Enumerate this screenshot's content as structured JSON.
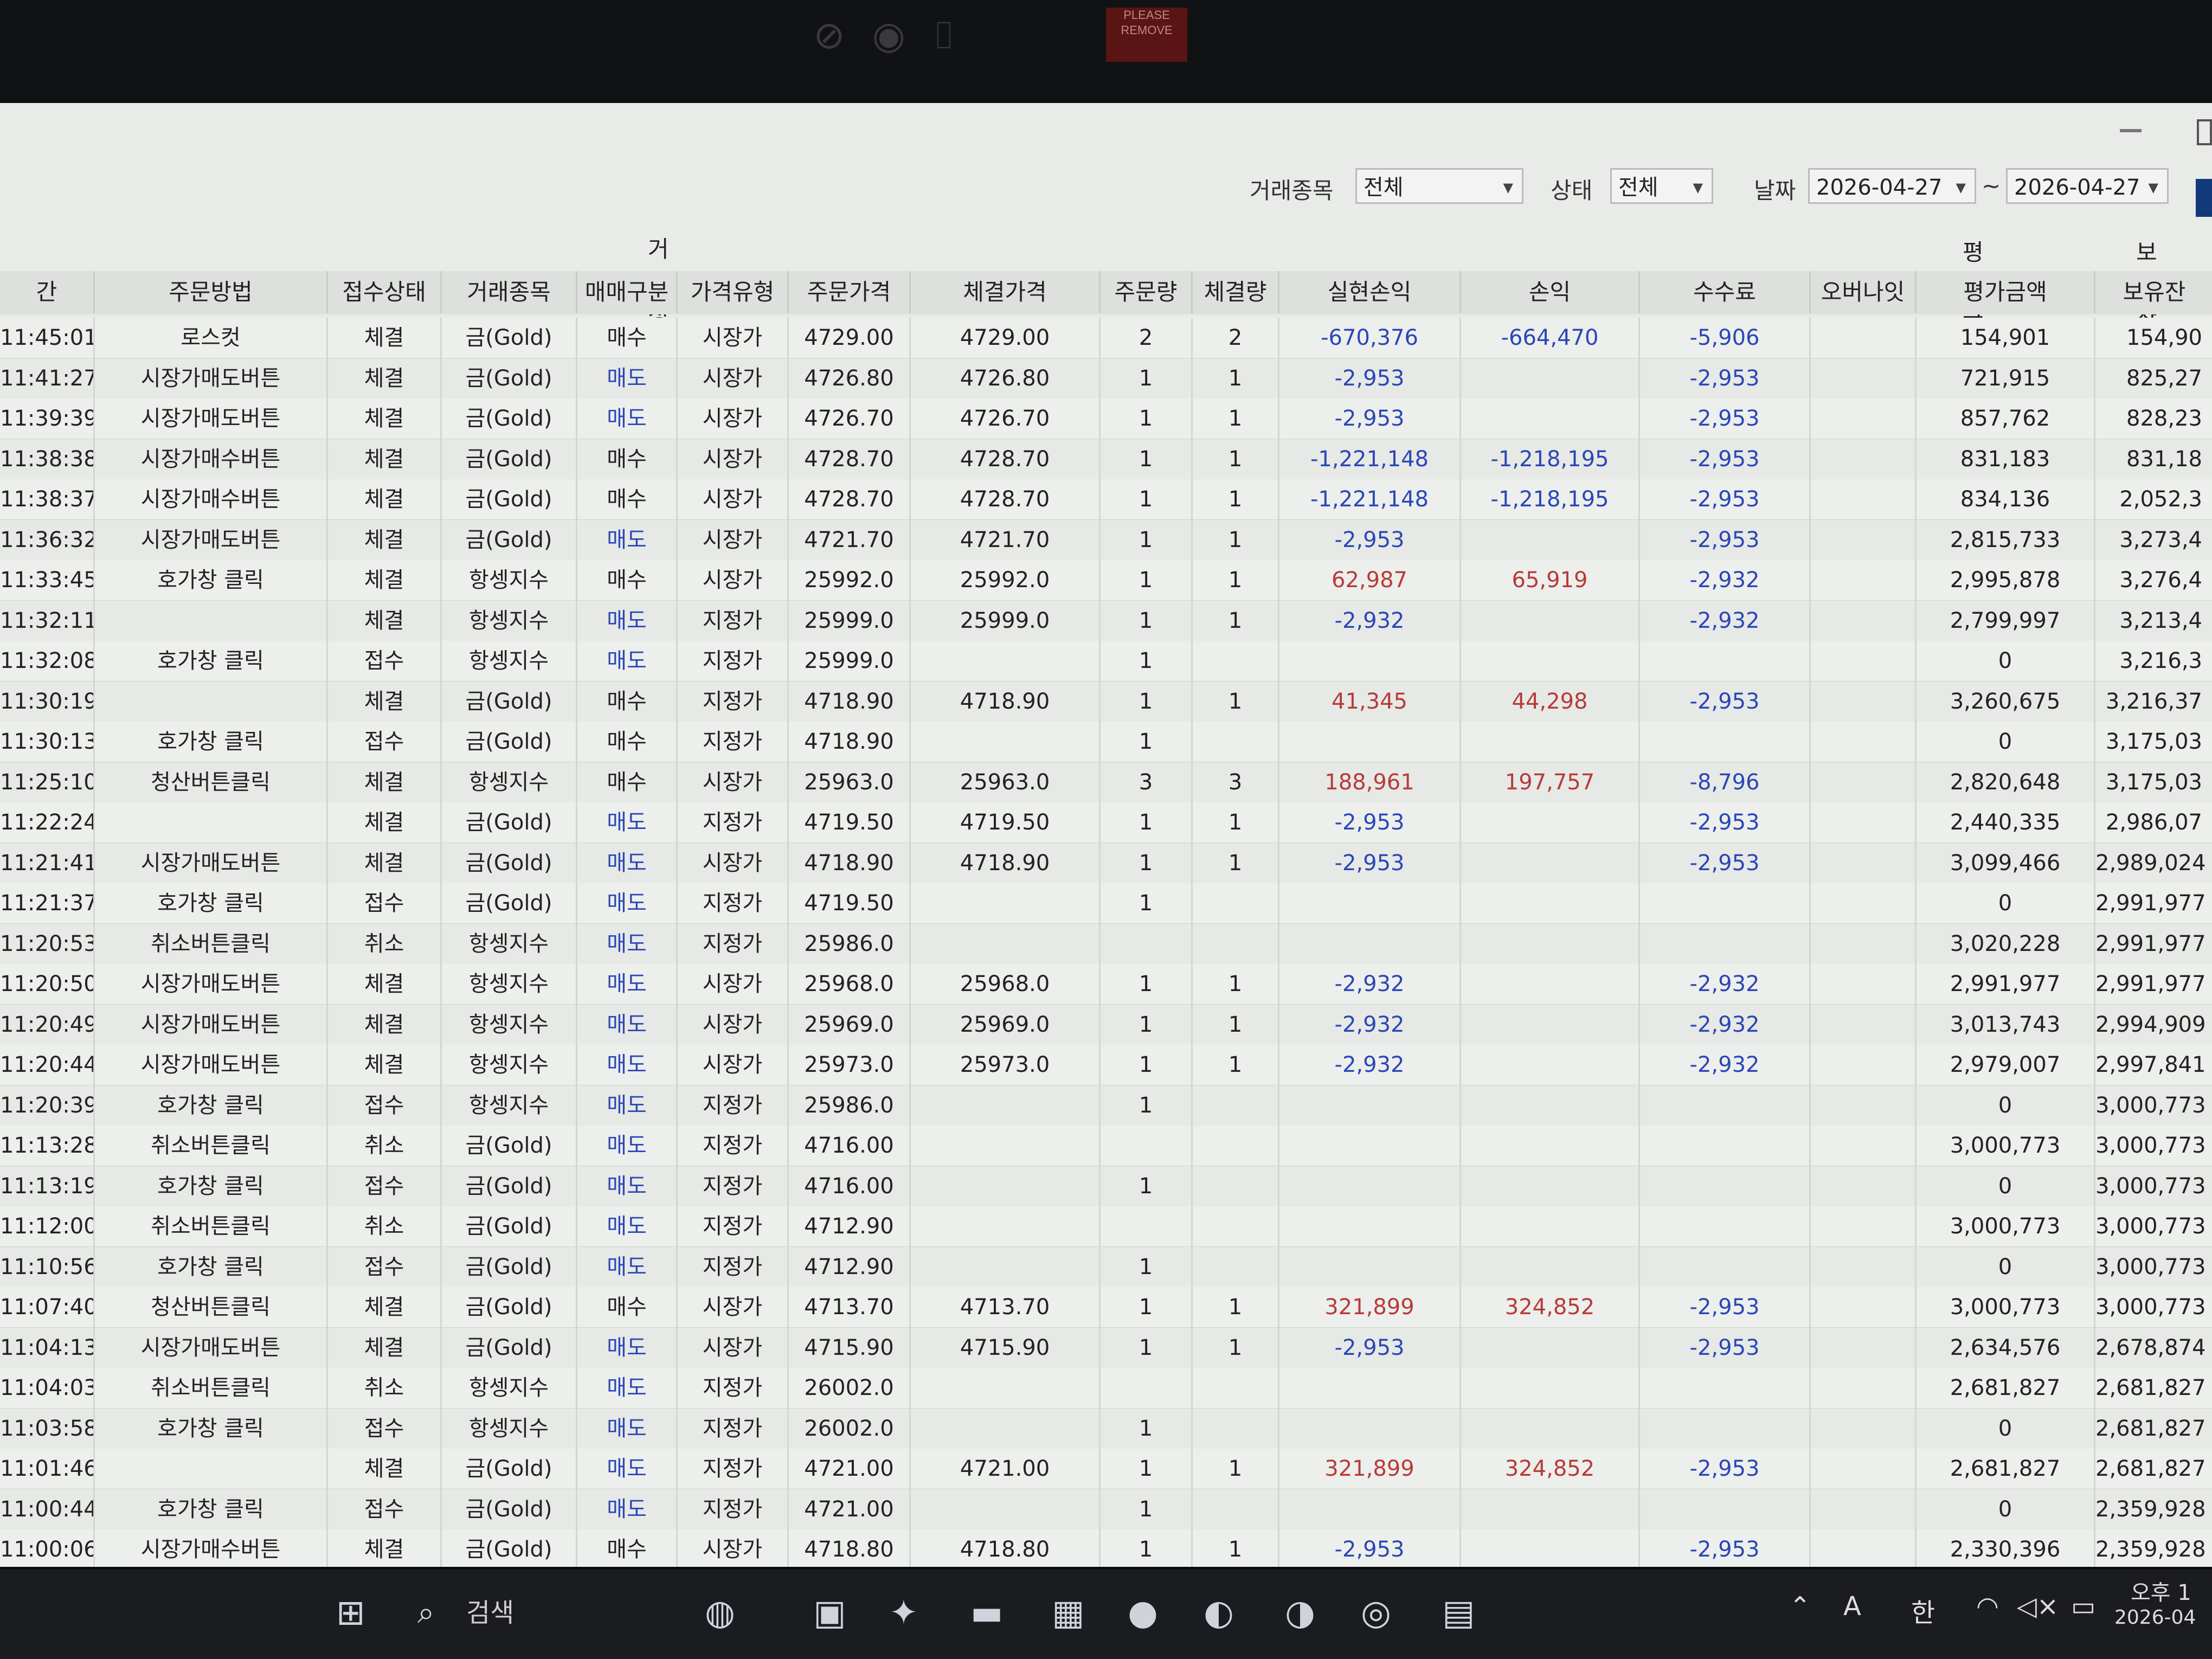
{
  "overlay": {
    "please_remove": "PLEASE REMOVE"
  },
  "filters": {
    "symbol_label": "거래종목",
    "symbol_value": "전체",
    "status_label": "상태",
    "status_value": "전체",
    "date_label": "날짜",
    "date_from": "2026-04-27",
    "date_sep": "~",
    "date_to": "2026-04-27"
  },
  "group_headers": {
    "trade_info": "거래정보",
    "eval_amount": "평가금액",
    "holding": "보유잔"
  },
  "columns": [
    "간",
    "주문방법",
    "접수상태",
    "거래종목",
    "매매구분",
    "가격유형",
    "주문가격",
    "체결가격",
    "주문량",
    "체결량",
    "실현손익",
    "손익",
    "수수료",
    "오버나잇",
    "평가금액",
    "보유잔"
  ],
  "rows": [
    [
      "11:45:01",
      "로스컷",
      "체결",
      "금(Gold)",
      "매수",
      "시장가",
      "4729.00",
      "4729.00",
      "2",
      "2",
      "-670,376",
      "-664,470",
      "-5,906",
      "",
      "154,901",
      "154,90"
    ],
    [
      "11:41:27",
      "시장가매도버튼",
      "체결",
      "금(Gold)",
      "매도",
      "시장가",
      "4726.80",
      "4726.80",
      "1",
      "1",
      "-2,953",
      "",
      "-2,953",
      "",
      "721,915",
      "825,27"
    ],
    [
      "11:39:39",
      "시장가매도버튼",
      "체결",
      "금(Gold)",
      "매도",
      "시장가",
      "4726.70",
      "4726.70",
      "1",
      "1",
      "-2,953",
      "",
      "-2,953",
      "",
      "857,762",
      "828,23"
    ],
    [
      "11:38:38",
      "시장가매수버튼",
      "체결",
      "금(Gold)",
      "매수",
      "시장가",
      "4728.70",
      "4728.70",
      "1",
      "1",
      "-1,221,148",
      "-1,218,195",
      "-2,953",
      "",
      "831,183",
      "831,18"
    ],
    [
      "11:38:37",
      "시장가매수버튼",
      "체결",
      "금(Gold)",
      "매수",
      "시장가",
      "4728.70",
      "4728.70",
      "1",
      "1",
      "-1,221,148",
      "-1,218,195",
      "-2,953",
      "",
      "834,136",
      "2,052,3"
    ],
    [
      "11:36:32",
      "시장가매도버튼",
      "체결",
      "금(Gold)",
      "매도",
      "시장가",
      "4721.70",
      "4721.70",
      "1",
      "1",
      "-2,953",
      "",
      "-2,953",
      "",
      "2,815,733",
      "3,273,4"
    ],
    [
      "11:33:45",
      "호가창 클릭",
      "체결",
      "항셍지수",
      "매수",
      "시장가",
      "25992.0",
      "25992.0",
      "1",
      "1",
      "62,987",
      "65,919",
      "-2,932",
      "",
      "2,995,878",
      "3,276,4"
    ],
    [
      "11:32:11",
      "",
      "체결",
      "항셍지수",
      "매도",
      "지정가",
      "25999.0",
      "25999.0",
      "1",
      "1",
      "-2,932",
      "",
      "-2,932",
      "",
      "2,799,997",
      "3,213,4"
    ],
    [
      "11:32:08",
      "호가창 클릭",
      "접수",
      "항셍지수",
      "매도",
      "지정가",
      "25999.0",
      "",
      "1",
      "",
      "",
      "",
      "",
      "",
      "0",
      "3,216,3"
    ],
    [
      "11:30:19",
      "",
      "체결",
      "금(Gold)",
      "매수",
      "지정가",
      "4718.90",
      "4718.90",
      "1",
      "1",
      "41,345",
      "44,298",
      "-2,953",
      "",
      "3,260,675",
      "3,216,37"
    ],
    [
      "11:30:13",
      "호가창 클릭",
      "접수",
      "금(Gold)",
      "매수",
      "지정가",
      "4718.90",
      "",
      "1",
      "",
      "",
      "",
      "",
      "",
      "0",
      "3,175,03"
    ],
    [
      "11:25:10",
      "청산버튼클릭",
      "체결",
      "항셍지수",
      "매수",
      "시장가",
      "25963.0",
      "25963.0",
      "3",
      "3",
      "188,961",
      "197,757",
      "-8,796",
      "",
      "2,820,648",
      "3,175,03"
    ],
    [
      "11:22:24",
      "",
      "체결",
      "금(Gold)",
      "매도",
      "지정가",
      "4719.50",
      "4719.50",
      "1",
      "1",
      "-2,953",
      "",
      "-2,953",
      "",
      "2,440,335",
      "2,986,07"
    ],
    [
      "11:21:41",
      "시장가매도버튼",
      "체결",
      "금(Gold)",
      "매도",
      "시장가",
      "4718.90",
      "4718.90",
      "1",
      "1",
      "-2,953",
      "",
      "-2,953",
      "",
      "3,099,466",
      "2,989,024"
    ],
    [
      "11:21:37",
      "호가창 클릭",
      "접수",
      "금(Gold)",
      "매도",
      "지정가",
      "4719.50",
      "",
      "1",
      "",
      "",
      "",
      "",
      "",
      "0",
      "2,991,977"
    ],
    [
      "11:20:53",
      "취소버튼클릭",
      "취소",
      "항셍지수",
      "매도",
      "지정가",
      "25986.0",
      "",
      "",
      "",
      "",
      "",
      "",
      "",
      "3,020,228",
      "2,991,977"
    ],
    [
      "11:20:50",
      "시장가매도버튼",
      "체결",
      "항셍지수",
      "매도",
      "시장가",
      "25968.0",
      "25968.0",
      "1",
      "1",
      "-2,932",
      "",
      "-2,932",
      "",
      "2,991,977",
      "2,991,977"
    ],
    [
      "11:20:49",
      "시장가매도버튼",
      "체결",
      "항셍지수",
      "매도",
      "시장가",
      "25969.0",
      "25969.0",
      "1",
      "1",
      "-2,932",
      "",
      "-2,932",
      "",
      "3,013,743",
      "2,994,909"
    ],
    [
      "11:20:44",
      "시장가매도버튼",
      "체결",
      "항셍지수",
      "매도",
      "시장가",
      "25973.0",
      "25973.0",
      "1",
      "1",
      "-2,932",
      "",
      "-2,932",
      "",
      "2,979,007",
      "2,997,841"
    ],
    [
      "11:20:39",
      "호가창 클릭",
      "접수",
      "항셍지수",
      "매도",
      "지정가",
      "25986.0",
      "",
      "1",
      "",
      "",
      "",
      "",
      "",
      "0",
      "3,000,773"
    ],
    [
      "11:13:28",
      "취소버튼클릭",
      "취소",
      "금(Gold)",
      "매도",
      "지정가",
      "4716.00",
      "",
      "",
      "",
      "",
      "",
      "",
      "",
      "3,000,773",
      "3,000,773"
    ],
    [
      "11:13:19",
      "호가창 클릭",
      "접수",
      "금(Gold)",
      "매도",
      "지정가",
      "4716.00",
      "",
      "1",
      "",
      "",
      "",
      "",
      "",
      "0",
      "3,000,773"
    ],
    [
      "11:12:00",
      "취소버튼클릭",
      "취소",
      "금(Gold)",
      "매도",
      "지정가",
      "4712.90",
      "",
      "",
      "",
      "",
      "",
      "",
      "",
      "3,000,773",
      "3,000,773"
    ],
    [
      "11:10:56",
      "호가창 클릭",
      "접수",
      "금(Gold)",
      "매도",
      "지정가",
      "4712.90",
      "",
      "1",
      "",
      "",
      "",
      "",
      "",
      "0",
      "3,000,773"
    ],
    [
      "11:07:40",
      "청산버튼클릭",
      "체결",
      "금(Gold)",
      "매수",
      "시장가",
      "4713.70",
      "4713.70",
      "1",
      "1",
      "321,899",
      "324,852",
      "-2,953",
      "",
      "3,000,773",
      "3,000,773"
    ],
    [
      "11:04:13",
      "시장가매도버튼",
      "체결",
      "금(Gold)",
      "매도",
      "시장가",
      "4715.90",
      "4715.90",
      "1",
      "1",
      "-2,953",
      "",
      "-2,953",
      "",
      "2,634,576",
      "2,678,874"
    ],
    [
      "11:04:03",
      "취소버튼클릭",
      "취소",
      "항셍지수",
      "매도",
      "지정가",
      "26002.0",
      "",
      "",
      "",
      "",
      "",
      "",
      "",
      "2,681,827",
      "2,681,827"
    ],
    [
      "11:03:58",
      "호가창 클릭",
      "접수",
      "항셍지수",
      "매도",
      "지정가",
      "26002.0",
      "",
      "1",
      "",
      "",
      "",
      "",
      "",
      "0",
      "2,681,827"
    ],
    [
      "11:01:46",
      "",
      "체결",
      "금(Gold)",
      "매도",
      "지정가",
      "4721.00",
      "4721.00",
      "1",
      "1",
      "321,899",
      "324,852",
      "-2,953",
      "",
      "2,681,827",
      "2,681,827"
    ],
    [
      "11:00:44",
      "호가창 클릭",
      "접수",
      "금(Gold)",
      "매도",
      "지정가",
      "4721.00",
      "",
      "1",
      "",
      "",
      "",
      "",
      "",
      "0",
      "2,359,928"
    ],
    [
      "11:00:06",
      "시장가매수버튼",
      "체결",
      "금(Gold)",
      "매수",
      "시장가",
      "4718.80",
      "4718.80",
      "1",
      "1",
      "-2,953",
      "",
      "-2,953",
      "",
      "2,330,396",
      "2,359,928"
    ]
  ],
  "taskbar": {
    "search_placeholder": "검색",
    "ime_a": "A",
    "ime_han": "한",
    "clock_ampm": "오후 1",
    "clock_date": "2026-04"
  },
  "colors": {
    "loss": "#2b46b8",
    "profit": "#b83a3a",
    "sell": "#2b46b8"
  }
}
